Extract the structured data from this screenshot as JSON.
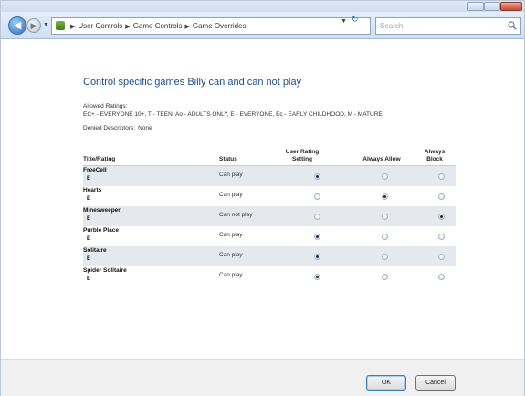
{
  "window": {
    "breadcrumb": [
      "User Controls",
      "Game Controls",
      "Game Overrides"
    ],
    "search_placeholder": "Search"
  },
  "page": {
    "title": "Control specific games Billy can and can not play",
    "allowed_label": "Allowed Ratings:",
    "allowed_value": "EC+ - EVERYONE 10+, T - TEEN, Ao - ADULTS ONLY, E - EVERYONE, Ec - EARLY CHILDHOOD, M - MATURE",
    "denied_label": "Denied Descriptors:",
    "denied_value": "None"
  },
  "table": {
    "headers": {
      "title": "Title/Rating",
      "status": "Status",
      "user_line1": "User Rating",
      "user_line2": "Setting",
      "allow": "Always Allow",
      "block_line1": "Always",
      "block_line2": "Block"
    },
    "rows": [
      {
        "game": "FreeCell",
        "rating": "E",
        "status": "Can play",
        "selected": "user"
      },
      {
        "game": "Hearts",
        "rating": "E",
        "status": "Can play",
        "selected": "allow"
      },
      {
        "game": "Minesweeper",
        "rating": "E",
        "status": "Can not play",
        "selected": "block"
      },
      {
        "game": "Purble Place",
        "rating": "E",
        "status": "Can play",
        "selected": "user"
      },
      {
        "game": "Solitaire",
        "rating": "E",
        "status": "Can play",
        "selected": "user"
      },
      {
        "game": "Spider Solitaire",
        "rating": "E",
        "status": "Can play",
        "selected": "user"
      }
    ]
  },
  "footer": {
    "ok_label": "OK",
    "cancel_label": "Cancel"
  }
}
